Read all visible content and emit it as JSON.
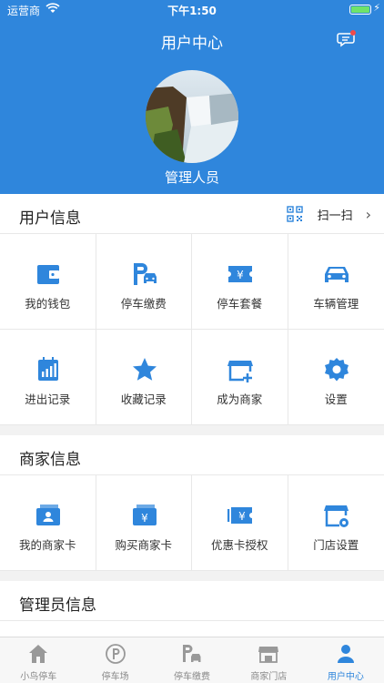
{
  "status_bar": {
    "carrier": "运营商",
    "time": "下午1:50"
  },
  "header": {
    "title": "用户中心",
    "username": "管理人员"
  },
  "user_info": {
    "title": "用户信息",
    "scan_label": "扫一扫",
    "items": [
      {
        "label": "我的钱包",
        "icon": "wallet-icon"
      },
      {
        "label": "停车缴费",
        "icon": "parking-pay-icon"
      },
      {
        "label": "停车套餐",
        "icon": "parking-package-icon"
      },
      {
        "label": "车辆管理",
        "icon": "car-icon"
      },
      {
        "label": "进出记录",
        "icon": "records-icon"
      },
      {
        "label": "收藏记录",
        "icon": "star-icon"
      },
      {
        "label": "成为商家",
        "icon": "become-merchant-icon"
      },
      {
        "label": "设置",
        "icon": "gear-icon"
      }
    ]
  },
  "merchant_info": {
    "title": "商家信息",
    "items": [
      {
        "label": "我的商家卡",
        "icon": "merchant-card-icon"
      },
      {
        "label": "购买商家卡",
        "icon": "buy-card-icon"
      },
      {
        "label": "优惠卡授权",
        "icon": "coupon-icon"
      },
      {
        "label": "门店设置",
        "icon": "store-settings-icon"
      }
    ]
  },
  "admin_info": {
    "title": "管理员信息"
  },
  "tab_bar": {
    "items": [
      {
        "label": "小鸟停车",
        "icon": "home-icon"
      },
      {
        "label": "停车场",
        "icon": "parking-lot-icon"
      },
      {
        "label": "停车缴费",
        "icon": "parking-pay-icon"
      },
      {
        "label": "商家门店",
        "icon": "store-icon"
      },
      {
        "label": "用户中心",
        "icon": "user-icon",
        "active": true
      }
    ]
  },
  "colors": {
    "primary": "#2f86dc",
    "inactive_tab": "#888888",
    "battery": "#6fe36a"
  }
}
